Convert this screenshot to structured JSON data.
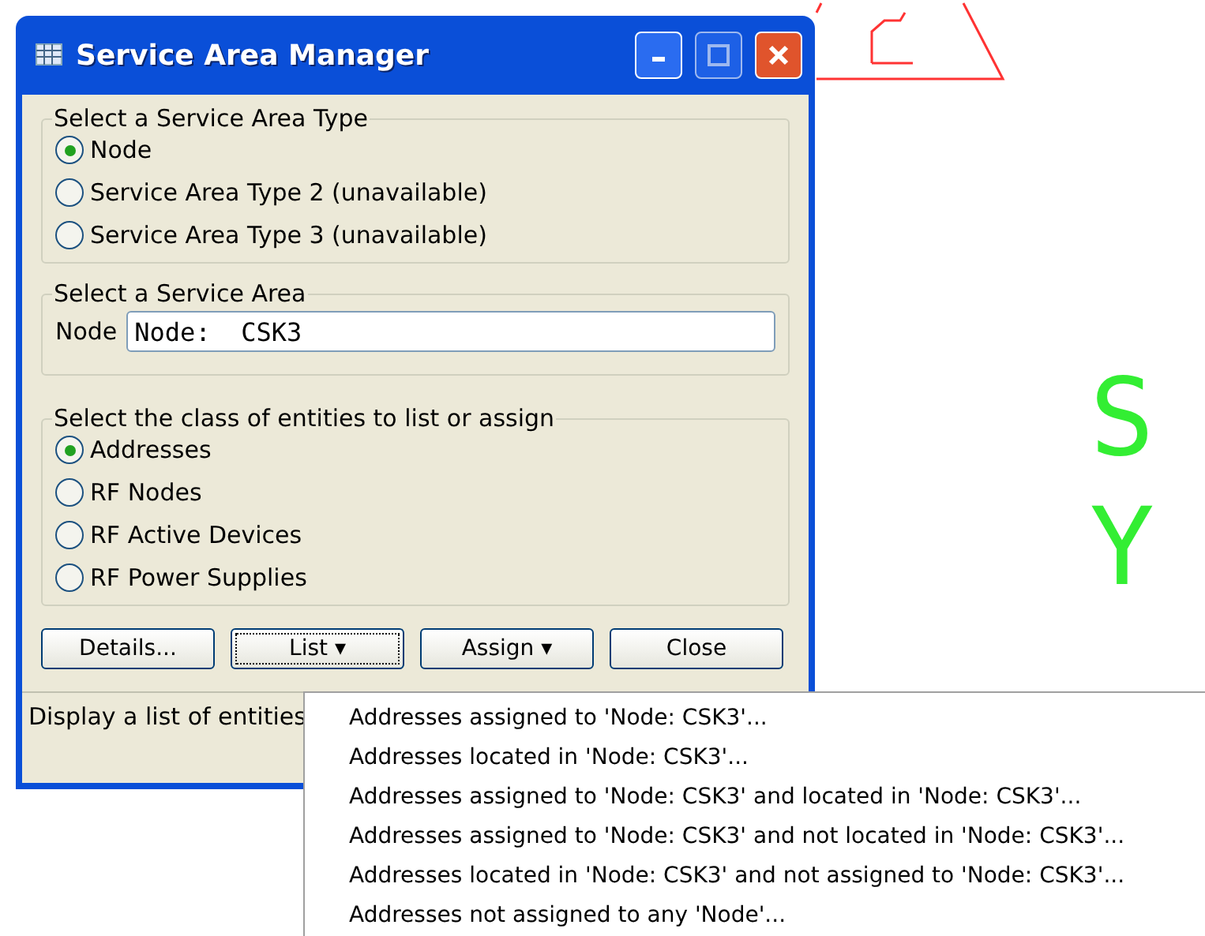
{
  "window": {
    "title": "Service Area Manager"
  },
  "type_group": {
    "legend": "Select a Service Area Type",
    "options": [
      {
        "label": "Node",
        "selected": true
      },
      {
        "label": "Service Area Type 2 (unavailable)",
        "selected": false
      },
      {
        "label": "Service Area Type 3 (unavailable)",
        "selected": false
      }
    ]
  },
  "area_group": {
    "legend": "Select a Service Area",
    "field_label": "Node",
    "value": "Node:  CSK3"
  },
  "class_group": {
    "legend": "Select the class of entities to list or assign",
    "options": [
      {
        "label": "Addresses",
        "selected": true
      },
      {
        "label": "RF Nodes",
        "selected": false
      },
      {
        "label": "RF Active Devices",
        "selected": false
      },
      {
        "label": "RF Power Supplies",
        "selected": false
      }
    ]
  },
  "buttons": [
    {
      "label": "Details...",
      "focused": false
    },
    {
      "label": "List ▾",
      "focused": true
    },
    {
      "label": "Assign ▾",
      "focused": false
    },
    {
      "label": "Close",
      "focused": false
    }
  ],
  "status_bar": "Display a list of entities",
  "menu": [
    "Addresses assigned to 'Node: CSK3'...",
    "Addresses located in 'Node: CSK3'...",
    "Addresses assigned to 'Node: CSK3' and located in 'Node: CSK3'...",
    "Addresses assigned to 'Node: CSK3' and not located in 'Node: CSK3'...",
    "Addresses located in 'Node: CSK3' and not assigned to 'Node: CSK3'...",
    "Addresses not assigned to any 'Node'..."
  ],
  "background_labels": [
    "S",
    "Y"
  ]
}
